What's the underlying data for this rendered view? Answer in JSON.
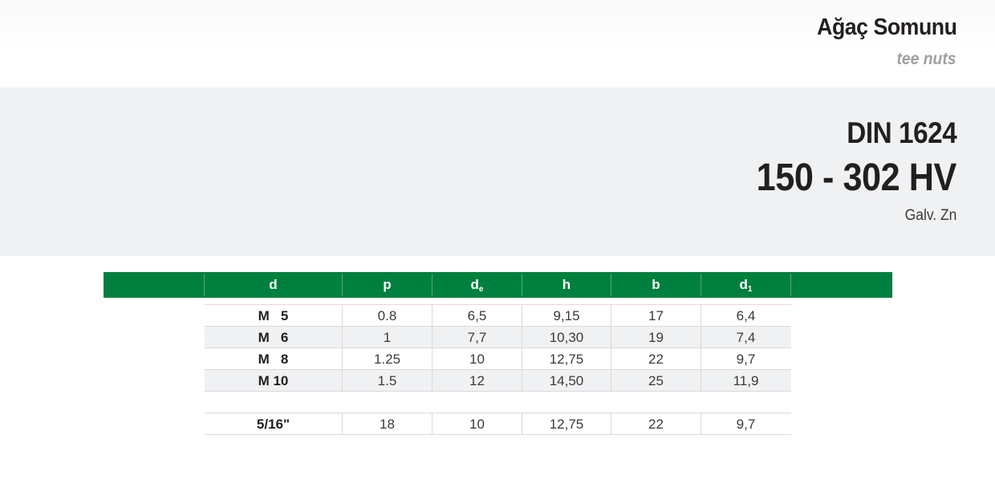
{
  "header": {
    "title": "Ağaç Somunu",
    "subtitle": "tee nuts"
  },
  "spec": {
    "standard": "DIN 1624",
    "hardness": "150 - 302 HV",
    "coating": "Galv. Zn"
  },
  "table": {
    "columns": [
      {
        "main": "d",
        "sub": ""
      },
      {
        "main": "p",
        "sub": ""
      },
      {
        "main": "d",
        "sub": "e"
      },
      {
        "main": "h",
        "sub": ""
      },
      {
        "main": "b",
        "sub": ""
      },
      {
        "main": "d",
        "sub": "1"
      }
    ],
    "metric_rows": [
      [
        "M   5",
        "0.8",
        "6,5",
        "9,15",
        "17",
        "6,4"
      ],
      [
        "M   6",
        "1",
        "7,7",
        "10,30",
        "19",
        "7,4"
      ],
      [
        "M   8",
        "1.25",
        "10",
        "12,75",
        "22",
        "9,7"
      ],
      [
        "M 10",
        "1.5",
        "12",
        "14,50",
        "25",
        "11,9"
      ]
    ],
    "inch_rows": [
      [
        "5/16\"",
        "18",
        "10",
        "12,75",
        "22",
        "9,7"
      ]
    ]
  },
  "colors": {
    "header_green": "#00803e",
    "band_gray": "#f0f1f3",
    "subtitle_gray": "#a0a0a0"
  }
}
